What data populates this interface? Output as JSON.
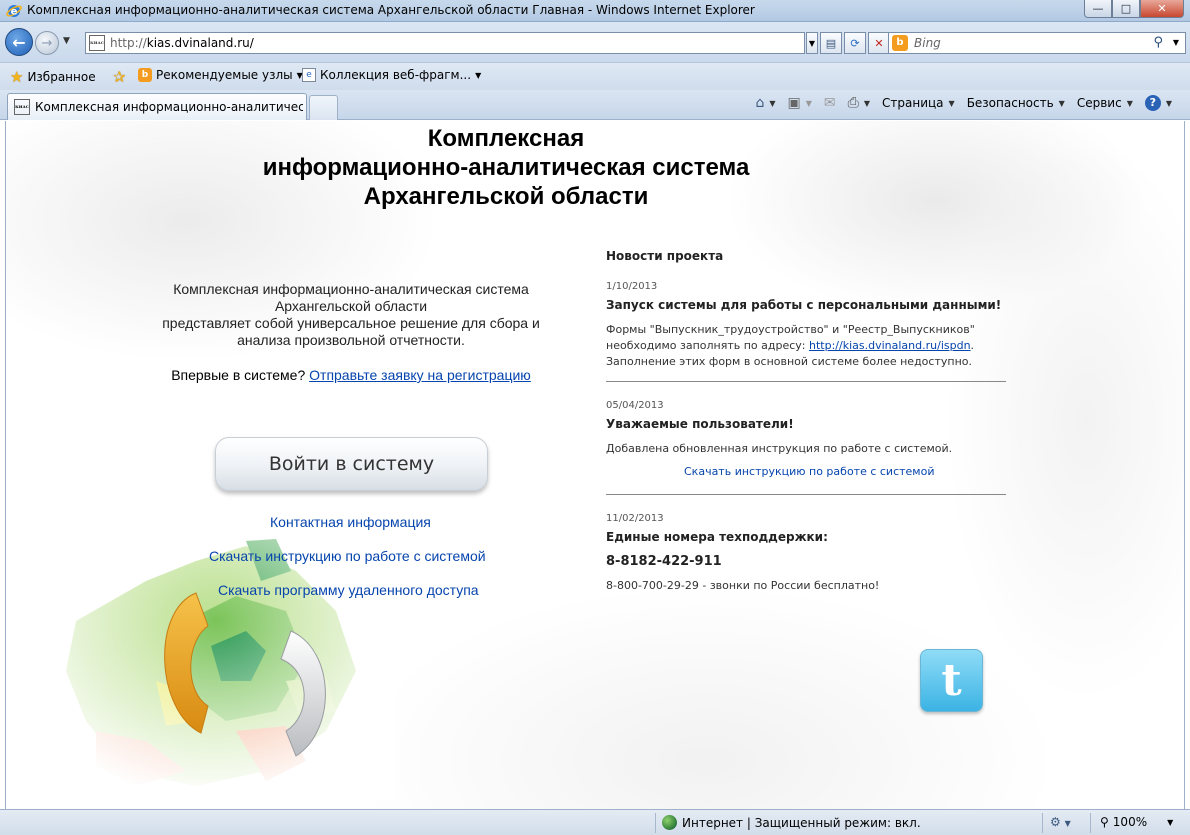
{
  "window": {
    "title": "Комплексная информационно-аналитическая система Архангельской области Главная - Windows Internet Explorer",
    "minimize": "—",
    "maximize": "□",
    "close": "✕"
  },
  "navigation": {
    "url_prefix": "http://",
    "url_host": "kias.dvinaland.ru/",
    "search_placeholder": "Bing",
    "site_icon_text": "КИАС"
  },
  "favorites_bar": {
    "favorites_label": "Избранное",
    "suggested_sites": "Рекомендуемые узлы",
    "web_slice_gallery": "Коллекция веб-фрагм..."
  },
  "tab": {
    "label": "Комплексная информационно-аналитическая..."
  },
  "command_bar": {
    "page": "Страница",
    "safety": "Безопасность",
    "tools": "Сервис",
    "help": "?"
  },
  "page": {
    "title_line1": "Комплексная",
    "title_line2": "информационно-аналитическая система",
    "title_line3": "Архангельской области",
    "intro_line1": "Комплексная информационно-аналитическая система",
    "intro_line2": "Архангельской области",
    "intro_line3": "представляет собой универсальное решение для сбора и",
    "intro_line4": "анализа произвольной отчетности.",
    "first_time": "Впервые в системе?",
    "register_link": "Отправьте заявку на регистрацию",
    "login_button": "Войти в систему",
    "contact_link": "Контактная информация",
    "download_manual_link": "Скачать инструкцию по работе с системой",
    "download_remote_link": "Скачать программу удаленного доступа"
  },
  "news": {
    "heading": "Новости проекта",
    "items": [
      {
        "date": "1/10/2013",
        "title": "Запуск системы для работы с персональными данными!",
        "body_line1": "Формы \"Выпускник_трудоустройство\" и \"Реестр_Выпускников\"",
        "body_line2_prefix": "необходимо заполнять по адресу: ",
        "body_link": "http://kias.dvinaland.ru/ispdn",
        "body_line2_suffix": ".",
        "body_line3": "Заполнение этих форм в основной системе более недоступно."
      },
      {
        "date": "05/04/2013",
        "title": "Уважаемые пользователи!",
        "body": "Добавлена обновленная инструкция по работе с системой.",
        "link": "Скачать инструкцию по работе с системой"
      },
      {
        "date": "11/02/2013",
        "title": "Единые номера техподдержки:",
        "phone": "8-8182-422-911",
        "body": "8-800-700-29-29 - звонки по России бесплатно!"
      }
    ]
  },
  "status_bar": {
    "zone": "Интернет | Защищенный режим: вкл.",
    "zoom": "100%"
  },
  "colors": {
    "link": "#0645ad",
    "twitter": "#3bb3e4"
  }
}
